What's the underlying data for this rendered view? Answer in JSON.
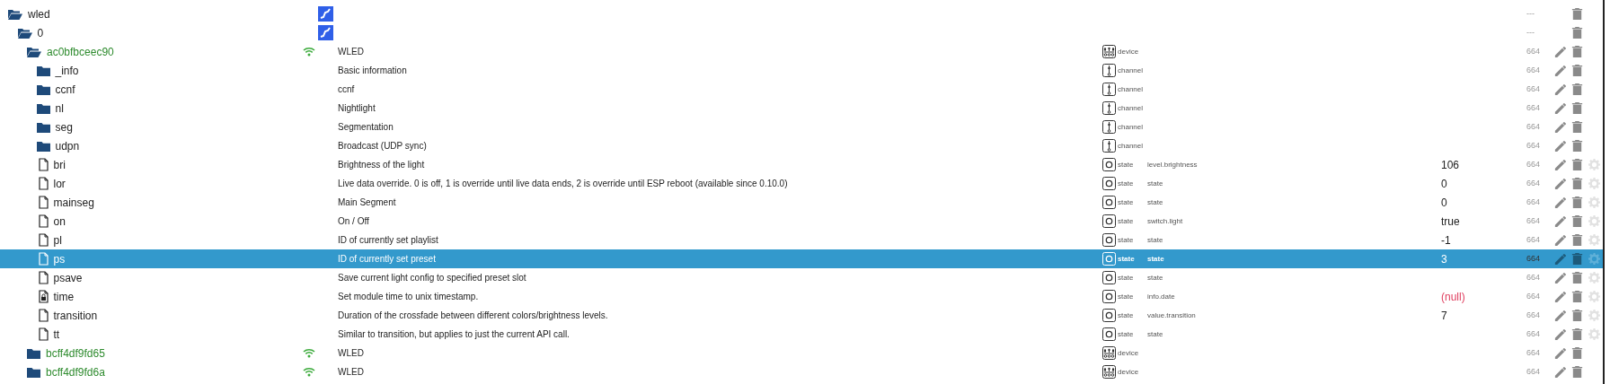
{
  "tree": [
    {
      "name": "wled",
      "kind": "adapter",
      "expanded": true,
      "selected": false,
      "acl": "---",
      "children": [
        {
          "name": "0",
          "kind": "instance",
          "expanded": true,
          "selected": false,
          "acl": "---",
          "children": [
            {
              "name": "ac0bfbceec90",
              "kind": "device",
              "expanded": true,
              "connected": true,
              "selected": false,
              "description": "WLED",
              "type": "device",
              "acl": "664",
              "children": [
                {
                  "name": "_info",
                  "kind": "channel",
                  "expanded": false,
                  "selected": false,
                  "description": "Basic information",
                  "type": "channel",
                  "acl": "664"
                },
                {
                  "name": "ccnf",
                  "kind": "channel",
                  "expanded": false,
                  "selected": false,
                  "description": "ccnf",
                  "type": "channel",
                  "acl": "664"
                },
                {
                  "name": "nl",
                  "kind": "channel",
                  "expanded": false,
                  "selected": false,
                  "description": "Nightlight",
                  "type": "channel",
                  "acl": "664"
                },
                {
                  "name": "seg",
                  "kind": "channel",
                  "expanded": false,
                  "selected": false,
                  "description": "Segmentation",
                  "type": "channel",
                  "acl": "664"
                },
                {
                  "name": "udpn",
                  "kind": "channel",
                  "expanded": false,
                  "selected": false,
                  "description": "Broadcast (UDP sync)",
                  "type": "channel",
                  "acl": "664"
                },
                {
                  "name": "bri",
                  "kind": "state",
                  "readonly": false,
                  "selected": false,
                  "description": "Brightness of the light",
                  "type": "state",
                  "role": "level.brightness",
                  "value": "106",
                  "acl": "664"
                },
                {
                  "name": "lor",
                  "kind": "state",
                  "readonly": false,
                  "selected": false,
                  "description": "Live data override. 0 is off, 1 is override until live data ends, 2 is override until ESP reboot (available since 0.10.0)",
                  "type": "state",
                  "role": "state",
                  "value": "0",
                  "acl": "664"
                },
                {
                  "name": "mainseg",
                  "kind": "state",
                  "readonly": false,
                  "selected": false,
                  "description": "Main Segment",
                  "type": "state",
                  "role": "state",
                  "value": "0",
                  "acl": "664"
                },
                {
                  "name": "on",
                  "kind": "state",
                  "readonly": false,
                  "selected": false,
                  "description": "On / Off",
                  "type": "state",
                  "role": "switch.light",
                  "value": "true",
                  "acl": "664"
                },
                {
                  "name": "pl",
                  "kind": "state",
                  "readonly": false,
                  "selected": false,
                  "description": "ID of currently set playlist",
                  "type": "state",
                  "role": "state",
                  "value": "-1",
                  "acl": "664"
                },
                {
                  "name": "ps",
                  "kind": "state",
                  "readonly": false,
                  "selected": true,
                  "description": "ID of currently set preset",
                  "type": "state",
                  "role": "state",
                  "value": "3",
                  "acl": "664"
                },
                {
                  "name": "psave",
                  "kind": "state",
                  "readonly": false,
                  "selected": false,
                  "description": "Save current light config to specified preset slot",
                  "type": "state",
                  "role": "state",
                  "acl": "664"
                },
                {
                  "name": "time",
                  "kind": "state",
                  "readonly": true,
                  "selected": false,
                  "description": "Set module time to unix timestamp.",
                  "type": "state",
                  "role": "info.date",
                  "value": "(null)",
                  "value_null": true,
                  "acl": "664"
                },
                {
                  "name": "transition",
                  "kind": "state",
                  "readonly": false,
                  "selected": false,
                  "description": "Duration of the crossfade between different colors/brightness levels.",
                  "type": "state",
                  "role": "value.transition",
                  "value": "7",
                  "acl": "664"
                },
                {
                  "name": "tt",
                  "kind": "state",
                  "readonly": false,
                  "selected": false,
                  "description": "Similar to transition, but applies to just the current API call.",
                  "type": "state",
                  "role": "state",
                  "acl": "664"
                }
              ]
            },
            {
              "name": "bcff4df9fd65",
              "kind": "device",
              "expanded": false,
              "connected": true,
              "selected": false,
              "description": "WLED",
              "type": "device",
              "acl": "664"
            },
            {
              "name": "bcff4df9fd6a",
              "kind": "device",
              "expanded": false,
              "connected": true,
              "selected": false,
              "description": "WLED",
              "type": "device",
              "acl": "664"
            }
          ]
        }
      ]
    }
  ]
}
